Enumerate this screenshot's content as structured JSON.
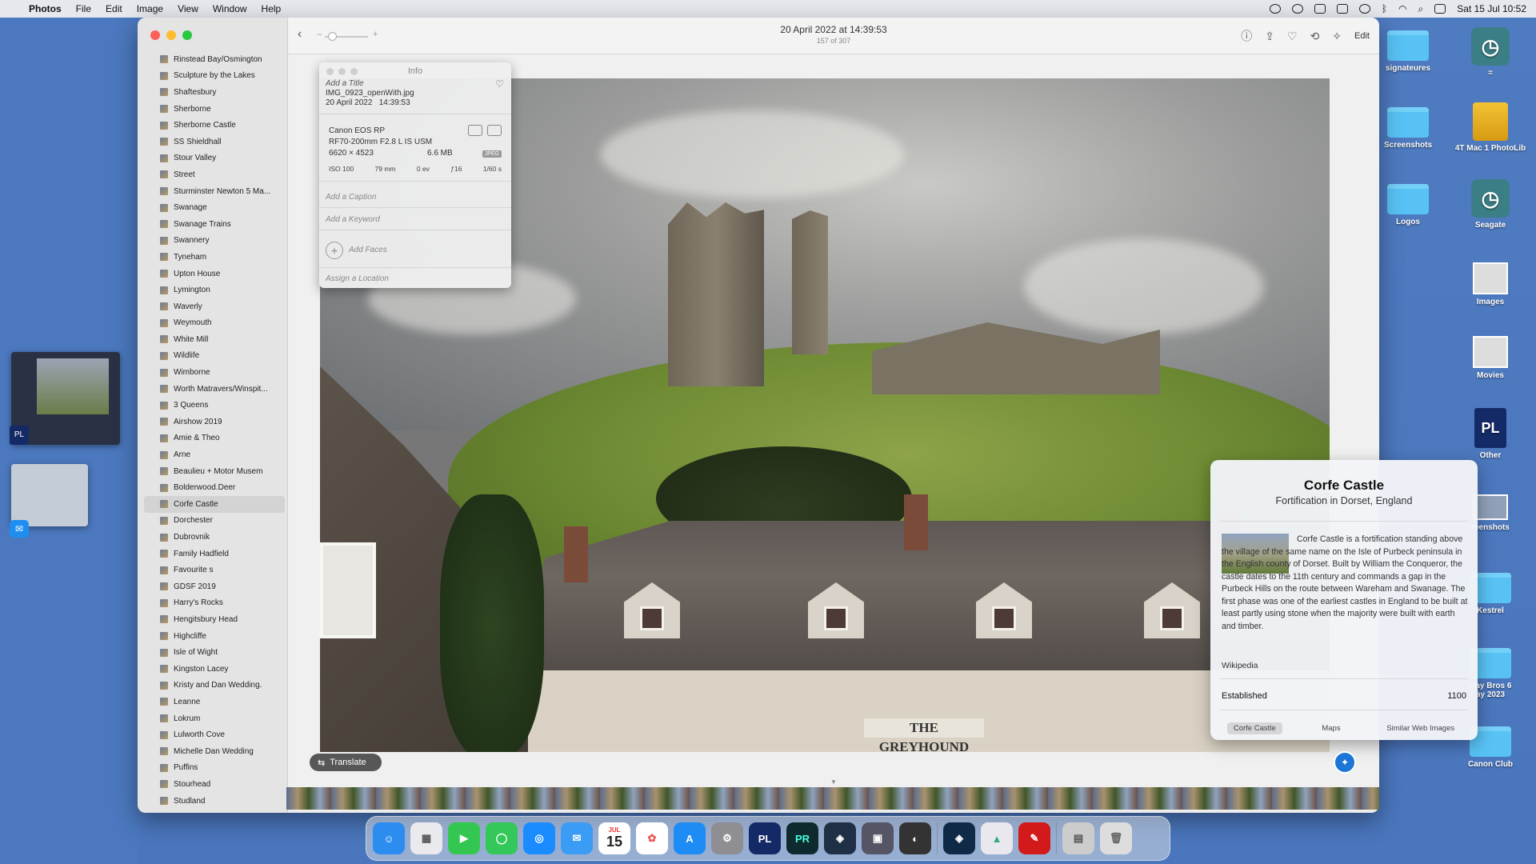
{
  "menubar": {
    "app": "Photos",
    "items": [
      "File",
      "Edit",
      "Image",
      "View",
      "Window",
      "Help"
    ],
    "clock": "Sat 15 Jul  10:52"
  },
  "desktop": {
    "right_col": [
      {
        "label": "signateures",
        "kind": "folder"
      },
      {
        "label": "Screenshots",
        "kind": "folder"
      },
      {
        "label": "Logos",
        "kind": "folder"
      },
      {
        "label": "",
        "kind": "other"
      }
    ],
    "far_right_col": [
      {
        "label": "=",
        "kind": "timemachine"
      },
      {
        "label": "4T Mac 1 PhotoLib",
        "kind": "drive"
      },
      {
        "label": "Seagate",
        "kind": "timemachine"
      },
      {
        "label": "Images",
        "kind": "file"
      },
      {
        "label": "Movies",
        "kind": "file"
      },
      {
        "label": "Other",
        "kind": "pl"
      },
      {
        "label": "reenshots",
        "kind": "thumb"
      },
      {
        "label": "Kestrel",
        "kind": "folder"
      },
      {
        "label": "way Bros  6\nay 2023",
        "kind": "folder"
      },
      {
        "label": "Canon Club",
        "kind": "folder"
      }
    ]
  },
  "sidebar": {
    "albums": [
      "Rinstead Bay/Osmington",
      "Sculpture by the Lakes",
      "Shaftesbury",
      "Sherborne",
      "Sherborne Castle",
      "SS Shieldhall",
      "Stour Valley",
      "Street",
      "Sturminster Newton 5 Ma...",
      "Swanage",
      "Swanage Trains",
      "Swannery",
      "Tyneham",
      "Upton House",
      "Lymington",
      "Waverly",
      "Weymouth",
      "White Mill",
      "Wildlife",
      "Wimborne",
      "Worth Matravers/Winspit...",
      "3 Queens",
      "Airshow 2019",
      "Amie & Theo",
      "Arne",
      "Beaulieu + Motor Musem",
      "Bolderwood.Deer",
      "Corfe Castle",
      "Dorchester",
      "Dubrovnik",
      "Family Hadfield",
      "Favourite s",
      "GDSF 2019",
      "Harry's Rocks",
      "Hengitsbury Head",
      "Highcliffe",
      "Isle of Wight",
      "Kingston Lacey",
      "Kristy and Dan Wedding.",
      "Leanne",
      "Lokrum",
      "Lulworth Cove",
      "Michelle Dan Wedding",
      "Puffins",
      "Stourhead",
      "Studland"
    ],
    "selected": "Corfe Castle"
  },
  "toolbar": {
    "title": "20 April 2022 at 14:39:53",
    "subtitle": "157 of 307",
    "edit_label": "Edit"
  },
  "info": {
    "header": "Info",
    "title_placeholder": "Add a Title",
    "filename": "IMG_0923_openWith.jpg",
    "date": "20 April 2022",
    "time": "14:39:53",
    "camera": "Canon EOS RP",
    "lens": "RF70-200mm F2.8 L IS USM",
    "resolution": "6620 × 4523",
    "filesize": "6.6 MB",
    "format": "JPEG",
    "exif": {
      "iso": "ISO 100",
      "focal": "79 mm",
      "ev": "0 ev",
      "aperture": "ƒ16",
      "shutter": "1/60 s"
    },
    "caption_placeholder": "Add a Caption",
    "keyword_placeholder": "Add a Keyword",
    "faces_label": "Add Faces",
    "location_placeholder": "Assign a Location"
  },
  "photo": {
    "sign_text": "THE GREYHOUND"
  },
  "knowledge": {
    "name": "Corfe Castle",
    "subtitle": "Fortification in Dorset, England",
    "description": "Corfe Castle is a fortification standing above the village of the same name on the Isle of Purbeck peninsula in the English county of Dorset. Built by William the Conqueror, the castle dates to the 11th century and commands a gap in the Purbeck Hills on the route between Wareham and Swanage. The first phase was one of the earliest castles in England to be built at least partly using stone when the majority were built with earth and timber.",
    "source": "Wikipedia",
    "fact_label": "Established",
    "fact_value": "1100",
    "tabs": [
      "Corfe Castle",
      "Maps",
      "Similar Web Images"
    ],
    "selected_tab": "Corfe Castle"
  },
  "translate_label": "Translate",
  "dock": {
    "calendar_month": "JUL",
    "calendar_day": "15",
    "app_labels": {
      "pl": "PL",
      "pr": "PR"
    }
  },
  "spaces": {
    "pl_badge": "PL"
  }
}
